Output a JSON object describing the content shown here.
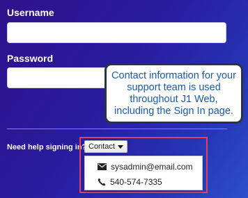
{
  "form": {
    "username_label": "Username",
    "password_label": "Password",
    "username_value": "",
    "password_value": ""
  },
  "help": {
    "prompt": "Need help signing in?",
    "contact_button_label": "Contact",
    "contact_items": [
      {
        "icon": "envelope-icon",
        "text": "sysadmin@email.com"
      },
      {
        "icon": "phone-icon",
        "text": "540-574-7335"
      }
    ]
  },
  "callout": {
    "text": "Contact information for your support team is used throughout J1 Web, including the Sign In page."
  },
  "colors": {
    "highlight_border": "#e0415f",
    "callout_text": "#1a5aa8",
    "callout_border": "#2a3342",
    "background_start": "#2e128c",
    "background_end": "#2c4fcb"
  }
}
